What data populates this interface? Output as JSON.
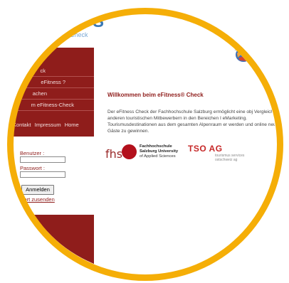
{
  "logo": {
    "text": "SS",
    "subtitle": "Check"
  },
  "nav": {
    "items": [
      {
        "label": "ck"
      },
      {
        "label": "eFitness ?"
      },
      {
        "label": "achen"
      },
      {
        "label": "m eFitness-Check"
      }
    ],
    "footer_links": [
      "Kontakt",
      "Impressum",
      "Home"
    ]
  },
  "login": {
    "username_label": "Benutzer :",
    "password_label": "Passwort :",
    "submit_label": "Anmelden",
    "forgot_password_link": "wort zusenden"
  },
  "main": {
    "welcome_heading": "Willkommen beim eFitness® Check",
    "intro_text": "Der eFitness Check der Fachhochschule Salzburg ermöglicht eine obj Vergleich mit anderen touristischen Mitbewerbern in den Bereichen I eMarketing. Tourismusdestinationen aus dem gesamten Alpenraum er werden und online neue Gäste zu gewinnen."
  },
  "partners": {
    "fhs": {
      "letters": "fhs",
      "name_line1": "Fachhochschule",
      "name_line2": "Salzburg University",
      "name_line3": "of Applied Sciences"
    },
    "tso": {
      "mark": "TSO AG",
      "sub_line1": "tourismus services",
      "sub_line2": "ostschweiz ag"
    }
  },
  "colors": {
    "ring": "#f5ae07",
    "sidebar": "#8f1d1b",
    "accent_red": "#c62828"
  }
}
